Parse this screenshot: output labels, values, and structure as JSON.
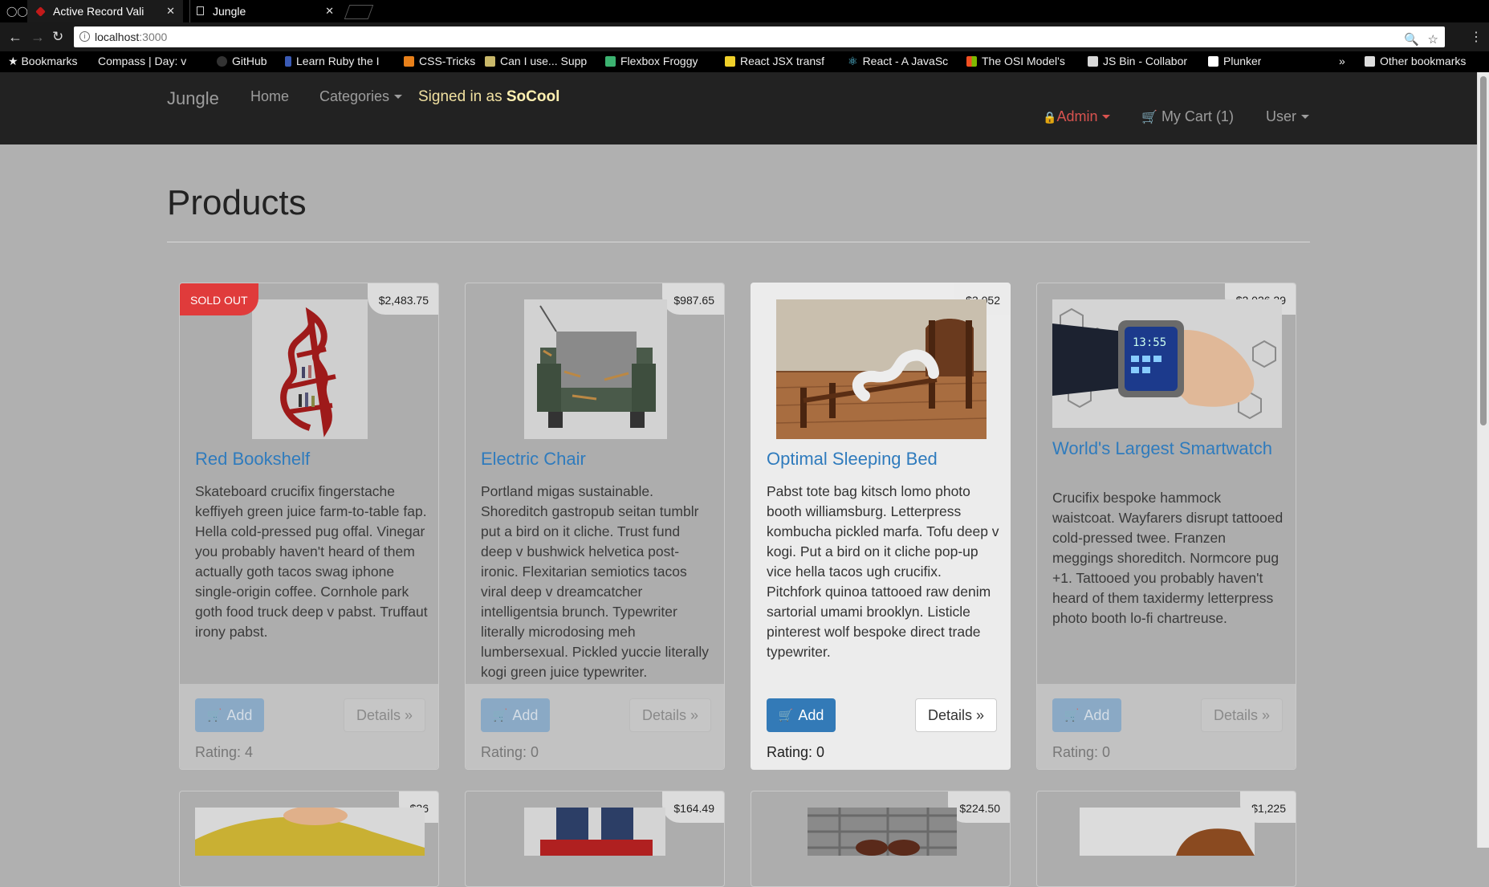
{
  "browser": {
    "tabs": [
      {
        "title": "Active Record Vali",
        "active": true
      },
      {
        "title": "Jungle",
        "active": false
      }
    ],
    "url_host": "localhost",
    "url_port": ":3000",
    "bookmarks": [
      "Bookmarks",
      "Compass | Day: v",
      "GitHub",
      "Learn Ruby the I",
      "CSS-Tricks",
      "Can I use... Supp",
      "Flexbox Froggy",
      "React JSX transf",
      "React - A JavaSc",
      "The OSI Model's",
      "JS Bin - Collabor",
      "Plunker",
      "»",
      "Other bookmarks"
    ]
  },
  "navbar": {
    "brand": "Jungle",
    "home": "Home",
    "categories": "Categories",
    "signed_prefix": "Signed in as",
    "signed_user": "SoCool",
    "admin": "Admin",
    "cart": "My Cart (1)",
    "user": "User"
  },
  "page": {
    "title": "Products"
  },
  "products": [
    {
      "name": "Red Bookshelf",
      "price": "$2,483.75",
      "sold_out": "SOLD OUT",
      "description": "Skateboard crucifix fingerstache keffiyeh green juice farm-to-table fap. Hella cold-pressed pug offal. Vinegar you probably haven't heard of them actually goth tacos swag iphone single-origin coffee. Cornhole park goth food truck deep v pabst. Truffaut irony pabst.",
      "add": "Add",
      "details": "Details »",
      "rating": "Rating: 4"
    },
    {
      "name": "Electric Chair",
      "price": "$987.65",
      "description": "Portland migas sustainable. Shoreditch gastropub seitan tumblr put a bird on it cliche. Trust fund deep v bushwick helvetica post-ironic. Flexitarian semiotics tacos viral deep v dreamcatcher intelligentsia brunch. Typewriter literally microdosing meh lumbersexual. Pickled yuccie literally kogi green juice typewriter.",
      "add": "Add",
      "details": "Details »",
      "rating": "Rating: 0"
    },
    {
      "name": "Optimal Sleeping Bed",
      "price": "$3,052",
      "description": "Pabst tote bag kitsch lomo photo booth williamsburg. Letterpress kombucha pickled marfa. Tofu deep v kogi. Put a bird on it cliche pop-up vice hella tacos ugh crucifix. Pitchfork quinoa tattooed raw denim sartorial umami brooklyn. Listicle pinterest wolf bespoke direct trade typewriter.",
      "add": "Add",
      "details": "Details »",
      "rating": "Rating: 0"
    },
    {
      "name": "World's Largest Smartwatch",
      "price": "$2,026.29",
      "watch_time": "13:55",
      "description": "Crucifix bespoke hammock waistcoat. Wayfarers disrupt tattooed cold-pressed twee. Franzen meggings shoreditch. Normcore pug +1. Tattooed you probably haven't heard of them taxidermy letterpress photo booth lo-fi chartreuse.",
      "add": "Add",
      "details": "Details »",
      "rating": "Rating: 0"
    }
  ],
  "second_row_prices": [
    "$26",
    "$164.49",
    "$224.50",
    "$1,225"
  ],
  "colors": {
    "navbar_bg": "#222222",
    "link_blue": "#2f7bbd",
    "primary_button": "#337ab7",
    "sold_out": "#e03b3b",
    "admin_red": "#d9534f",
    "overlay_grey": "#b0b0b0"
  }
}
